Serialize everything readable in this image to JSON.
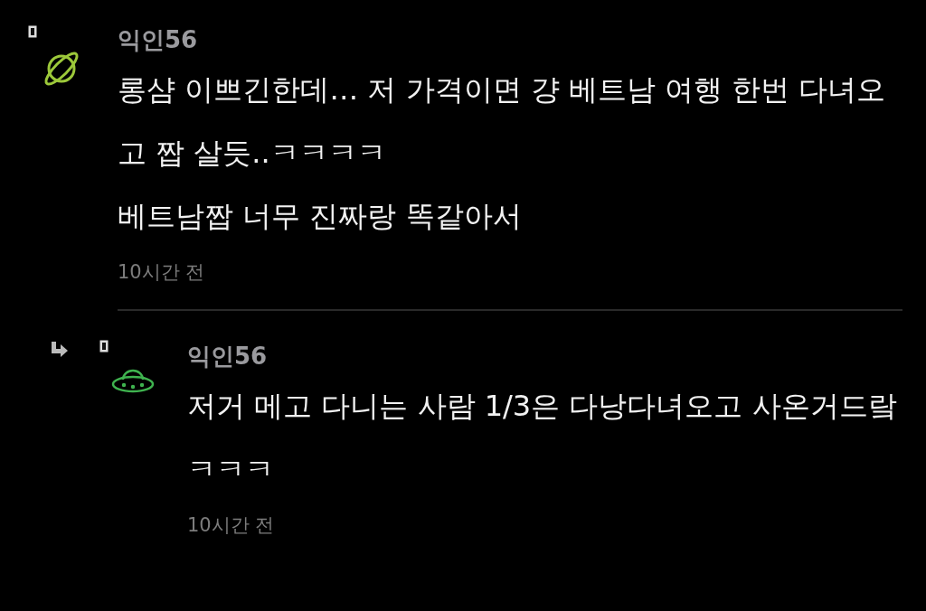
{
  "comments": [
    {
      "kind": "comment",
      "avatar": {
        "kind": "planet"
      },
      "author": "익인56",
      "paragraphs": [
        "롱샴 이쁘긴한데… 저 가격이면 걍 베트남 여행 한번 다녀오고 짭 살듯..ㅋㅋㅋㅋ",
        "베트남짭 너무 진짜랑 똑같아서"
      ],
      "time": "10시간 전"
    },
    {
      "kind": "reply",
      "avatar": {
        "kind": "ufo"
      },
      "author": "익인56",
      "paragraphs": [
        "저거 메고 다니는 사람 1/3은 다낭다녀오고 사온거드랔ㅋㅋㅋ"
      ],
      "time": "10시간 전"
    }
  ]
}
